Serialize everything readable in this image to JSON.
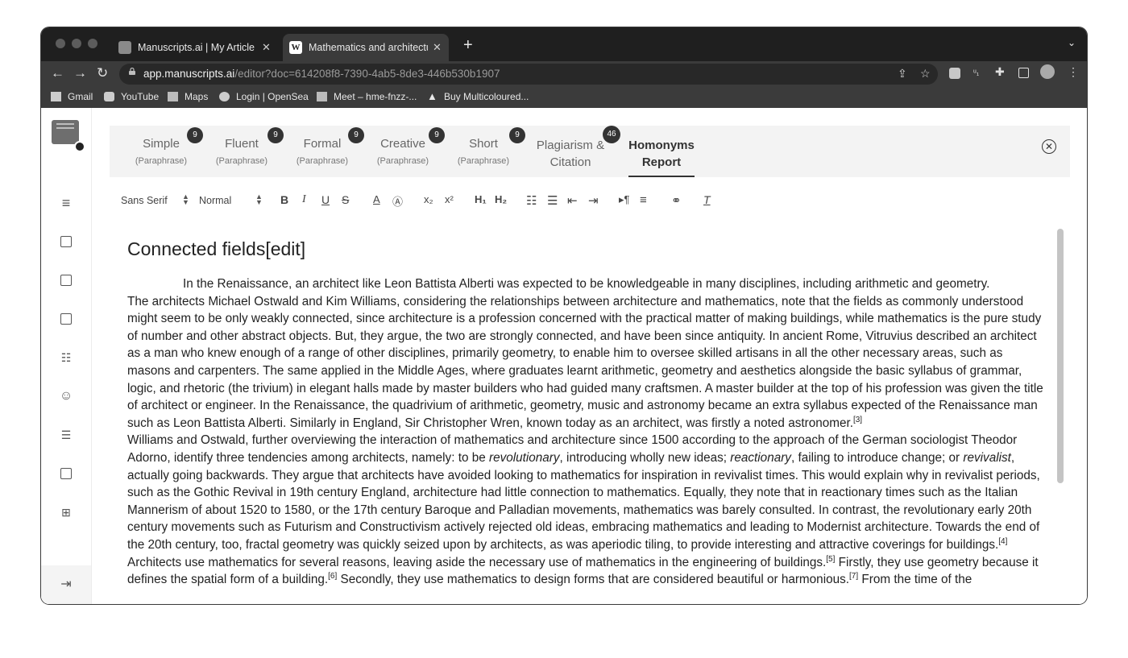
{
  "browser": {
    "tabs": [
      {
        "label": "Manuscripts.ai | My Article for",
        "active": false
      },
      {
        "label": "Mathematics and architecture",
        "active": true
      }
    ],
    "url_host": "app.manuscripts.ai",
    "url_path": "/editor?doc=614208f8-7390-4ab5-8de3-446b530b1907",
    "bookmarks": [
      "Gmail",
      "YouTube",
      "Maps",
      "Login | OpenSea",
      "Meet – hme-fnzz-...",
      "Buy Multicoloured..."
    ]
  },
  "modes": [
    {
      "name": "Simple",
      "sub": "(Paraphrase)",
      "badge": "9"
    },
    {
      "name": "Fluent",
      "sub": "(Paraphrase)",
      "badge": "9"
    },
    {
      "name": "Formal",
      "sub": "(Paraphrase)",
      "badge": "9"
    },
    {
      "name": "Creative",
      "sub": "(Paraphrase)",
      "badge": "9"
    },
    {
      "name": "Short",
      "sub": "(Paraphrase)",
      "badge": "9"
    },
    {
      "name": "Plagiarism & Citation",
      "badge": "46"
    },
    {
      "name": "Homonyms Report",
      "active": true
    }
  ],
  "toolbar": {
    "font": "Sans Serif",
    "size": "Normal"
  },
  "doc": {
    "heading": "Connected fields[edit]",
    "p1": "In the Renaissance, an architect like Leon Battista Alberti was expected to be knowledgeable in many disciplines, including arithmetic and geometry.",
    "p2": "The architects Michael Ostwald and Kim Williams, considering the relationships between architecture and mathematics, note that the fields as commonly understood might seem to be only weakly connected, since architecture is a profession concerned with the practical matter of making buildings, while mathematics is the pure study of number and other abstract objects. But, they argue, the two are strongly connected, and have been since antiquity. In ancient Rome, Vitruvius described an architect as a man who knew enough of a range of other disciplines, primarily geometry, to enable him to oversee skilled artisans in all the other necessary areas, such as masons and carpenters. The same applied in the Middle Ages, where graduates learnt arithmetic, geometry and aesthetics alongside the basic syllabus of grammar, logic, and rhetoric (the trivium) in elegant halls made by master builders who had guided many craftsmen. A master builder at the top of his profession was given the title of architect or engineer. In the Renaissance, the quadrivium of arithmetic, geometry, music and astronomy became an extra syllabus expected of the Renaissance man such as Leon Battista Alberti. Similarly in England, Sir Christopher Wren, known today as an architect, was firstly a noted astronomer.",
    "p2_ref": "[3]",
    "p3_a": "Williams and Ostwald, further overviewing the interaction of mathematics and architecture since 1500 according to the approach of the German sociologist Theodor Adorno, identify three tendencies among architects, namely: to be ",
    "p3_i1": "revolutionary",
    "p3_b": ", introducing wholly new ideas; ",
    "p3_i2": "reactionary",
    "p3_c": ", failing to introduce change; or ",
    "p3_i3": "revivalist",
    "p3_d": ", actually going backwards. They argue that architects have avoided looking to mathematics for inspiration in revivalist times. This would explain why in revivalist periods, such as the Gothic Revival in 19th century England, architecture had little connection to mathematics. Equally, they note that in reactionary times such as the Italian Mannerism of about 1520 to 1580, or the 17th century Baroque and Palladian movements, mathematics was barely consulted. In contrast, the revolutionary early 20th century movements such as Futurism and Constructivism actively rejected old ideas, embracing mathematics and leading to Modernist architecture. Towards the end of the 20th century, too, fractal geometry was quickly seized upon by architects, as was aperiodic tiling, to provide interesting and attractive coverings for buildings.",
    "p3_ref": "[4]",
    "p4_a": "Architects use mathematics for several reasons, leaving aside the necessary use of mathematics in the engineering of buildings.",
    "p4_ref1": "[5]",
    "p4_b": " Firstly, they use geometry because it defines the spatial form of a building.",
    "p4_ref2": "[6]",
    "p4_c": " Secondly, they use mathematics to design forms that are considered beautiful or harmonious.",
    "p4_ref3": "[7]",
    "p4_d": " From the time of the"
  }
}
